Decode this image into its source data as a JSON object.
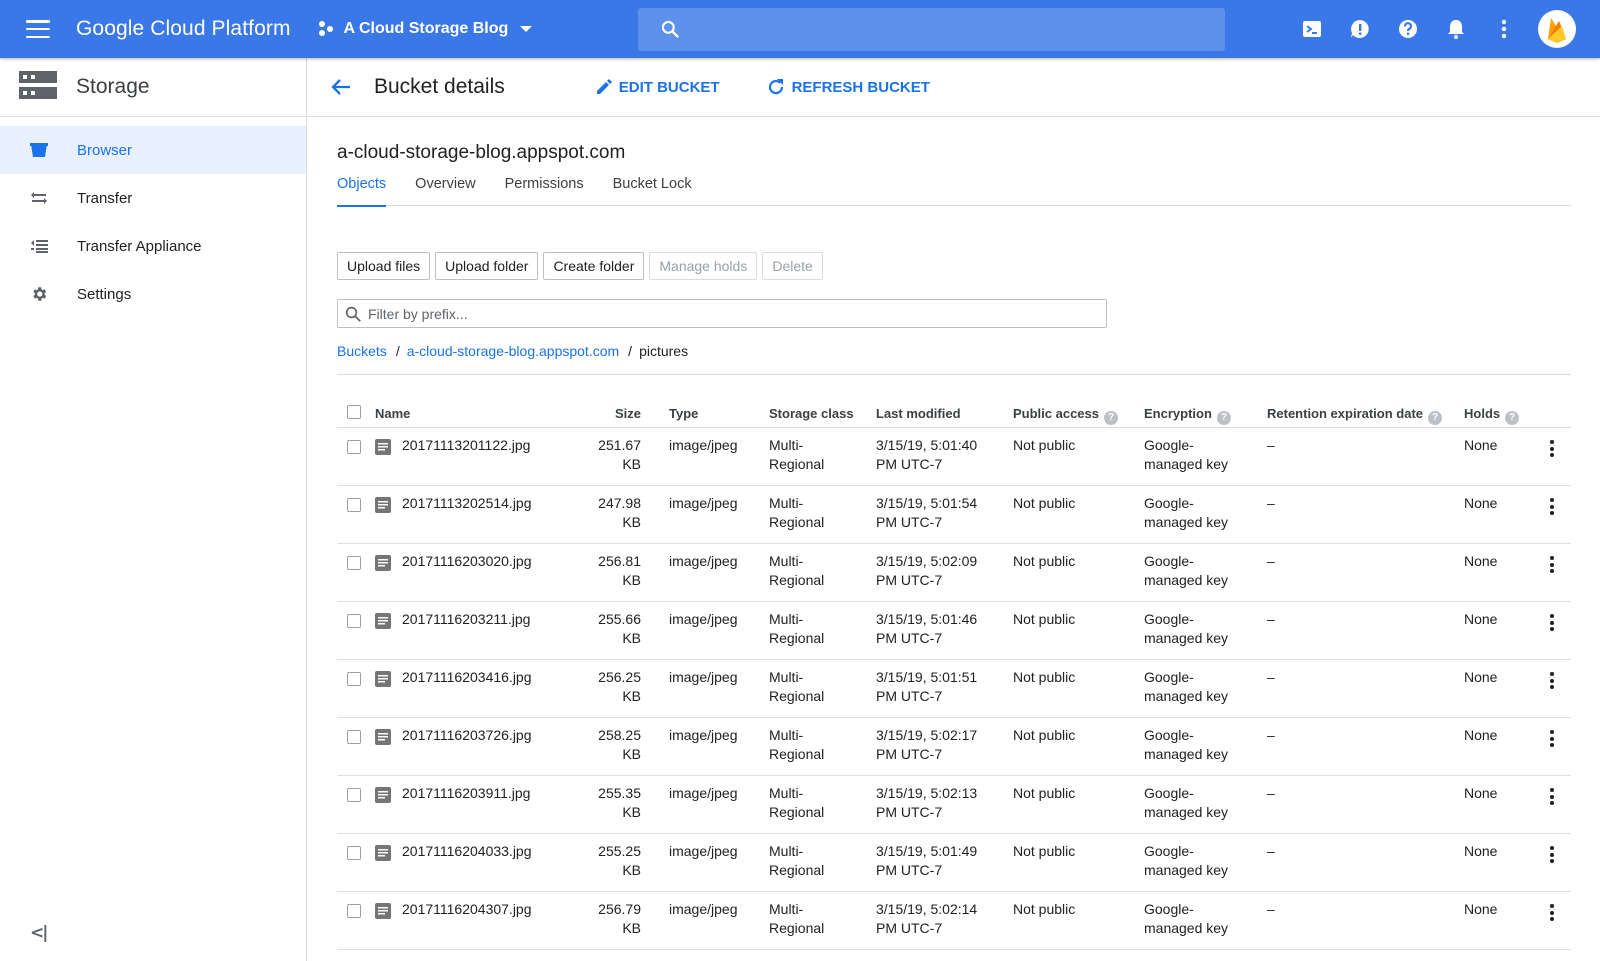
{
  "topbar": {
    "brand": "Google Cloud Platform",
    "project": "A Cloud Storage Blog",
    "icons": [
      "menu-icon",
      "project-icon",
      "caret-down-icon",
      "search-icon",
      "cloud-shell-icon",
      "feedback-icon",
      "help-icon",
      "notifications-icon",
      "more-vert-icon",
      "firebase-avatar-icon"
    ]
  },
  "sidebar": {
    "title": "Storage",
    "items": [
      {
        "label": "Browser",
        "icon": "bucket-icon",
        "active": true
      },
      {
        "label": "Transfer",
        "icon": "transfer-icon"
      },
      {
        "label": "Transfer Appliance",
        "icon": "transfer-appliance-icon"
      },
      {
        "label": "Settings",
        "icon": "gear-icon"
      }
    ],
    "collapse_icon": "collapse-icon"
  },
  "header": {
    "title": "Bucket details",
    "edit_label": "EDIT BUCKET",
    "refresh_label": "REFRESH BUCKET"
  },
  "bucket": {
    "name": "a-cloud-storage-blog.appspot.com",
    "tabs": [
      {
        "label": "Objects",
        "active": true
      },
      {
        "label": "Overview"
      },
      {
        "label": "Permissions"
      },
      {
        "label": "Bucket Lock"
      }
    ]
  },
  "actions": {
    "upload_files": "Upload files",
    "upload_folder": "Upload folder",
    "create_folder": "Create folder",
    "manage_holds": "Manage holds",
    "delete": "Delete"
  },
  "filter": {
    "placeholder": "Filter by prefix..."
  },
  "breadcrumb": {
    "buckets": "Buckets",
    "sep1": "/",
    "bucket": "a-cloud-storage-blog.appspot.com",
    "sep2": "/",
    "folder": "pictures"
  },
  "table": {
    "columns": {
      "name": "Name",
      "size": "Size",
      "type": "Type",
      "storage_class": "Storage class",
      "last_modified": "Last modified",
      "public_access": "Public access",
      "encryption": "Encryption",
      "retention": "Retention expiration date",
      "holds": "Holds"
    },
    "help_glyph": "?",
    "rows": [
      {
        "name": "20171113201122.jpg",
        "size_num": "251.67",
        "size_unit": "KB",
        "type": "image/jpeg",
        "class_1": "Multi-",
        "class_2": "Regional",
        "mod_1": "3/15/19, 5:01:40",
        "mod_2": "PM UTC-7",
        "public": "Not public",
        "enc_1": "Google-",
        "enc_2": "managed key",
        "retention": "–",
        "holds": "None"
      },
      {
        "name": "20171113202514.jpg",
        "size_num": "247.98",
        "size_unit": "KB",
        "type": "image/jpeg",
        "class_1": "Multi-",
        "class_2": "Regional",
        "mod_1": "3/15/19, 5:01:54",
        "mod_2": "PM UTC-7",
        "public": "Not public",
        "enc_1": "Google-",
        "enc_2": "managed key",
        "retention": "–",
        "holds": "None"
      },
      {
        "name": "20171116203020.jpg",
        "size_num": "256.81",
        "size_unit": "KB",
        "type": "image/jpeg",
        "class_1": "Multi-",
        "class_2": "Regional",
        "mod_1": "3/15/19, 5:02:09",
        "mod_2": "PM UTC-7",
        "public": "Not public",
        "enc_1": "Google-",
        "enc_2": "managed key",
        "retention": "–",
        "holds": "None"
      },
      {
        "name": "20171116203211.jpg",
        "size_num": "255.66",
        "size_unit": "KB",
        "type": "image/jpeg",
        "class_1": "Multi-",
        "class_2": "Regional",
        "mod_1": "3/15/19, 5:01:46",
        "mod_2": "PM UTC-7",
        "public": "Not public",
        "enc_1": "Google-",
        "enc_2": "managed key",
        "retention": "–",
        "holds": "None"
      },
      {
        "name": "20171116203416.jpg",
        "size_num": "256.25",
        "size_unit": "KB",
        "type": "image/jpeg",
        "class_1": "Multi-",
        "class_2": "Regional",
        "mod_1": "3/15/19, 5:01:51",
        "mod_2": "PM UTC-7",
        "public": "Not public",
        "enc_1": "Google-",
        "enc_2": "managed key",
        "retention": "–",
        "holds": "None"
      },
      {
        "name": "20171116203726.jpg",
        "size_num": "258.25",
        "size_unit": "KB",
        "type": "image/jpeg",
        "class_1": "Multi-",
        "class_2": "Regional",
        "mod_1": "3/15/19, 5:02:17",
        "mod_2": "PM UTC-7",
        "public": "Not public",
        "enc_1": "Google-",
        "enc_2": "managed key",
        "retention": "–",
        "holds": "None"
      },
      {
        "name": "20171116203911.jpg",
        "size_num": "255.35",
        "size_unit": "KB",
        "type": "image/jpeg",
        "class_1": "Multi-",
        "class_2": "Regional",
        "mod_1": "3/15/19, 5:02:13",
        "mod_2": "PM UTC-7",
        "public": "Not public",
        "enc_1": "Google-",
        "enc_2": "managed key",
        "retention": "–",
        "holds": "None"
      },
      {
        "name": "20171116204033.jpg",
        "size_num": "255.25",
        "size_unit": "KB",
        "type": "image/jpeg",
        "class_1": "Multi-",
        "class_2": "Regional",
        "mod_1": "3/15/19, 5:01:49",
        "mod_2": "PM UTC-7",
        "public": "Not public",
        "enc_1": "Google-",
        "enc_2": "managed key",
        "retention": "–",
        "holds": "None"
      },
      {
        "name": "20171116204307.jpg",
        "size_num": "256.79",
        "size_unit": "KB",
        "type": "image/jpeg",
        "class_1": "Multi-",
        "class_2": "Regional",
        "mod_1": "3/15/19, 5:02:14",
        "mod_2": "PM UTC-7",
        "public": "Not public",
        "enc_1": "Google-",
        "enc_2": "managed key",
        "retention": "–",
        "holds": "None"
      }
    ]
  },
  "colors": {
    "topbar": "#3b78e7",
    "search": "#5d91ec",
    "accent": "#1a73e8",
    "active_nav_bg": "#e8f0fe"
  }
}
